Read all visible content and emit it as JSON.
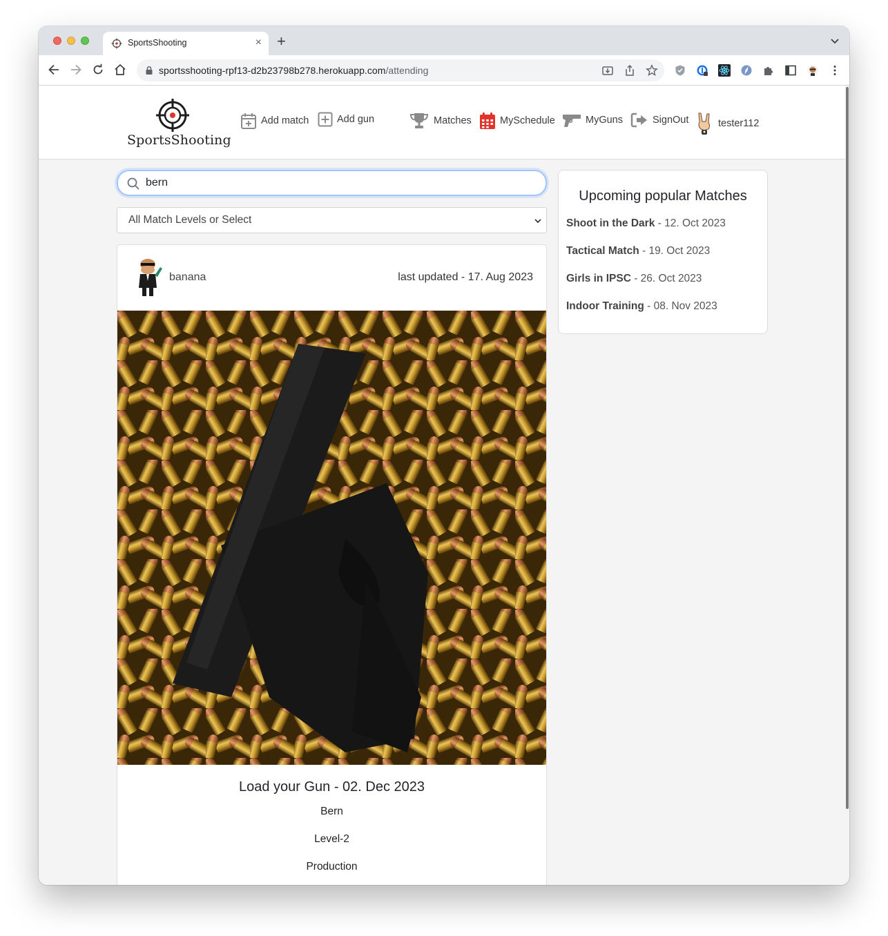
{
  "browser": {
    "tab_title": "SportsShooting",
    "tab_close": "×",
    "new_tab": "+",
    "url_host": "sportsshooting-rpf13-d2b23798b278.herokuapp.com",
    "url_path": "/attending"
  },
  "site": {
    "logo_text": "SportsShooting",
    "nav": {
      "add_match": "Add match",
      "add_gun": "Add gun",
      "matches": "Matches",
      "my_schedule": "MySchedule",
      "my_guns": "MyGuns",
      "sign_out": "SignOut",
      "user": "tester112"
    }
  },
  "filters": {
    "search_value": "bern",
    "level_select": "All Match Levels or Select"
  },
  "match_card": {
    "author": "banana",
    "updated": "last updated - 17. Aug 2023",
    "title": "Load your Gun - 02. Dec 2023",
    "location": "Bern",
    "level": "Level-2",
    "division": "Production"
  },
  "sidebar": {
    "title": "Upcoming popular Matches",
    "items": [
      {
        "name": "Shoot in the Dark",
        "date": " - 12. Oct 2023"
      },
      {
        "name": "Tactical Match",
        "date": " - 19. Oct 2023"
      },
      {
        "name": "Girls in IPSC",
        "date": " - 26. Oct 2023"
      },
      {
        "name": "Indoor Training",
        "date": " - 08. Nov 2023"
      }
    ]
  },
  "colors": {
    "schedule_icon": "#e0342c",
    "search_focus": "#9ec5fe",
    "nav_icon": "#8a8a8a"
  }
}
